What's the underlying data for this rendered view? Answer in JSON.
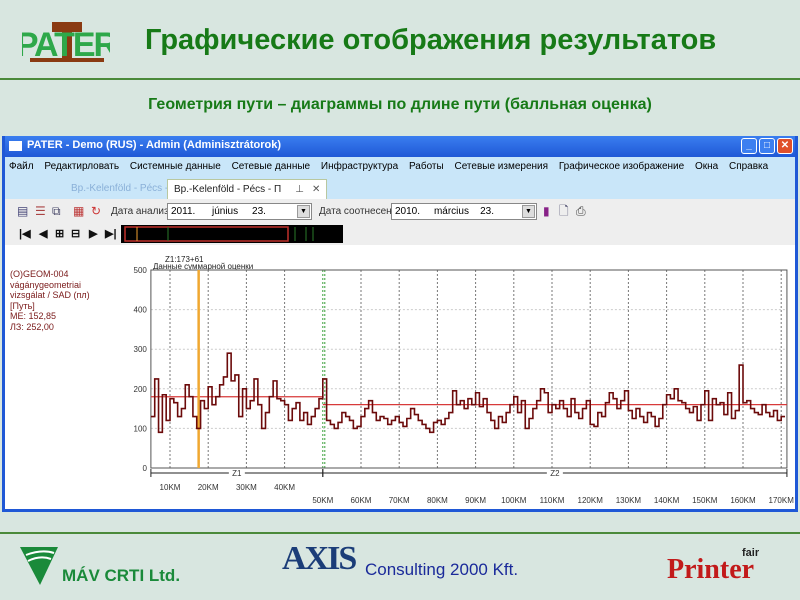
{
  "slide": {
    "logo": "PATER",
    "title": "Графические отображения результатов",
    "subtitle": "Геометрия пути – диаграммы по длине пути (балльная оценка)"
  },
  "window": {
    "title": "PATER - Demo (RUS) - Admin (Adminisztrátorok)",
    "menu": [
      "Файл",
      "Редактирловать",
      "Системные данные",
      "Сетевые данные",
      "Инфраструктура",
      "Работы",
      "Сетевые измерения",
      "Графическое изображение",
      "Окна",
      "Справка"
    ],
    "tabs": [
      {
        "label": "Bp.-Kelenföld - Pécs - П",
        "active": false
      },
      {
        "label": "Bp.-Kelenföld - Pécs - П",
        "active": true
      }
    ],
    "toolbar": {
      "analysis_date_label": "Дата анализа",
      "analysis_date": {
        "year": "2011.",
        "month": "június",
        "day": "23."
      },
      "compare_date_label": "Дата соотнесения",
      "compare_date": {
        "year": "2010.",
        "month": "március",
        "day": "23."
      }
    }
  },
  "info_panel": [
    "(O)GEOM-004",
    "vágánygeometriai",
    "vizsgálat / SAD (пл)",
    "[Путь]",
    "МЕ: 152,85",
    "ЛЗ: 252,00"
  ],
  "chart_data": {
    "type": "line",
    "title": "Данные суммарной оценки",
    "cursor_label": "Z1:173+61",
    "cursor_km": 17.5,
    "xlabel": "",
    "ylabel": "",
    "ylim": [
      0,
      500
    ],
    "yticks": [
      "0",
      "100",
      "200",
      "300",
      "400",
      "500"
    ],
    "xticks": [
      {
        "km": 10,
        "label": "10KM"
      },
      {
        "km": 20,
        "label": "20KM"
      },
      {
        "km": 30,
        "label": "30KM"
      },
      {
        "km": 40,
        "label": "40KM"
      },
      {
        "km": 50,
        "label": "50KM"
      },
      {
        "km": 60,
        "label": "60KM"
      },
      {
        "km": 70,
        "label": "70KM"
      },
      {
        "km": 80,
        "label": "80KM"
      },
      {
        "km": 90,
        "label": "90KM"
      },
      {
        "km": 100,
        "label": "100KM"
      },
      {
        "km": 110,
        "label": "110KM"
      },
      {
        "km": 120,
        "label": "120KM"
      },
      {
        "km": 130,
        "label": "130KM"
      },
      {
        "km": 140,
        "label": "140KM"
      },
      {
        "km": 150,
        "label": "150KM"
      },
      {
        "km": 160,
        "label": "160KM"
      },
      {
        "km": 170,
        "label": "170KM"
      }
    ],
    "xlim": [
      5,
      171.5
    ],
    "zones": [
      {
        "label": "Z1",
        "from": 5,
        "to": 50
      },
      {
        "label": "Z2",
        "from": 50,
        "to": 171.5
      }
    ],
    "limit_lines": [
      {
        "from": 5,
        "to": 50,
        "value": 180
      },
      {
        "from": 50,
        "to": 171.5,
        "value": 160
      }
    ],
    "x_start": 5,
    "x_step": 1,
    "values": [
      130,
      225,
      90,
      185,
      120,
      175,
      165,
      130,
      150,
      210,
      180,
      130,
      100,
      170,
      150,
      205,
      160,
      180,
      210,
      230,
      290,
      220,
      235,
      130,
      200,
      150,
      170,
      225,
      160,
      100,
      140,
      180,
      220,
      175,
      170,
      160,
      120,
      150,
      165,
      120,
      140,
      110,
      130,
      150,
      175,
      225,
      120,
      110,
      100,
      115,
      140,
      130,
      120,
      100,
      105,
      130,
      150,
      170,
      140,
      120,
      130,
      125,
      110,
      120,
      130,
      115,
      105,
      125,
      150,
      135,
      120,
      110,
      100,
      90,
      115,
      120,
      110,
      125,
      140,
      195,
      160,
      170,
      150,
      175,
      160,
      190,
      155,
      175,
      140,
      120,
      100,
      130,
      115,
      140,
      160,
      180,
      140,
      170,
      100,
      125,
      150,
      170,
      200,
      190,
      140,
      160,
      150,
      170,
      150,
      130,
      175,
      140,
      125,
      150,
      170,
      110,
      105,
      140,
      130,
      165,
      190,
      175,
      150,
      170,
      195,
      145,
      125,
      150,
      130,
      115,
      140,
      130,
      105,
      125,
      160,
      185,
      175,
      200,
      170,
      165,
      150,
      140,
      155,
      120,
      160,
      195,
      120,
      175,
      160,
      165,
      135,
      190,
      125,
      145,
      260,
      165,
      170,
      150,
      140,
      135,
      160,
      140,
      130,
      145,
      120,
      130
    ],
    "colors": {
      "series": "#6b0a0a",
      "limit": "#d83a3a",
      "cursor": "#f0a830",
      "zone_border": "#3aa03a"
    }
  },
  "footer": {
    "mav": "MÁV CRTI Ltd.",
    "axis_logo": "AXIS",
    "axis": "Consulting 2000 Kft.",
    "printer": "Printer",
    "printer_sup": "fair"
  }
}
